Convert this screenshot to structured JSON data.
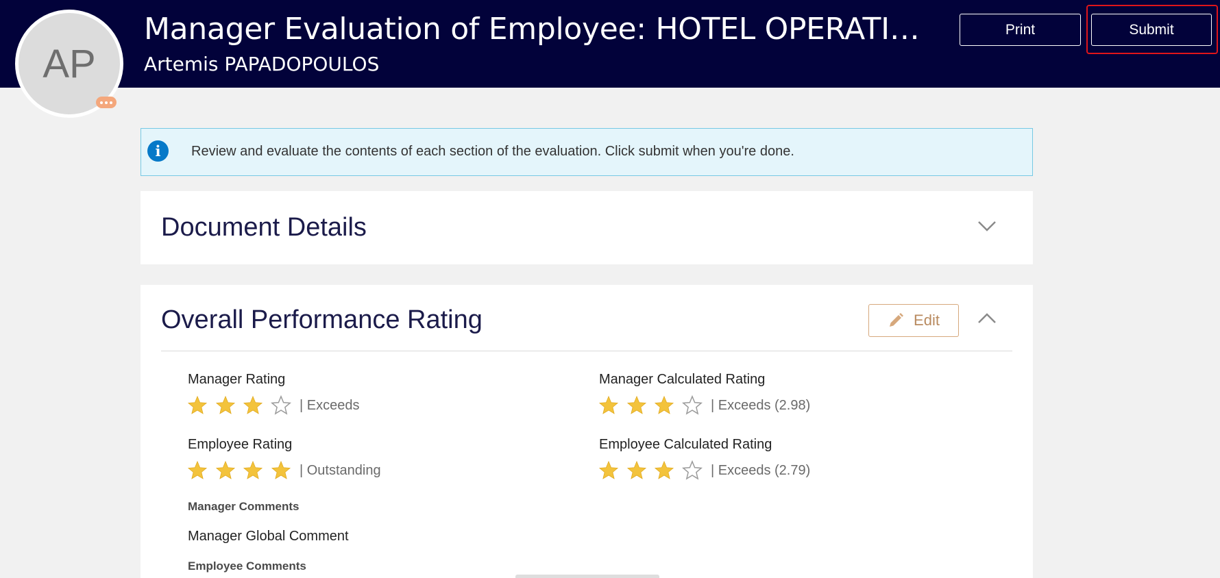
{
  "header": {
    "title": "Manager Evaluation of Employee: HOTEL OPERATIONS - GLOBAL",
    "subtitle": "Artemis PAPADOPOULOS",
    "avatar_initials": "AP",
    "print_label": "Print",
    "submit_label": "Submit",
    "background": "#02023a",
    "highlight_color": "#e0151a"
  },
  "info_banner": {
    "text": "Review and evaluate the contents of each section of the evaluation. Click submit when you're done.",
    "icon": "info-icon"
  },
  "document_details": {
    "title": "Document Details",
    "expanded": false
  },
  "overall_performance": {
    "title": "Overall Performance Rating",
    "edit_label": "Edit",
    "expanded": true,
    "manager_rating": {
      "label": "Manager Rating",
      "stars": 3,
      "max": 4,
      "text": "| Exceeds"
    },
    "employee_rating": {
      "label": "Employee Rating",
      "stars": 4,
      "max": 4,
      "text": "| Outstanding"
    },
    "manager_calculated": {
      "label": "Manager Calculated Rating",
      "stars": 3,
      "max": 4,
      "text": "| Exceeds (2.98)"
    },
    "employee_calculated": {
      "label": "Employee Calculated Rating",
      "stars": 3,
      "max": 4,
      "text": "| Exceeds (2.79)"
    },
    "manager_comments_label": "Manager Comments",
    "manager_comment": "Manager Global Comment",
    "employee_comments_label": "Employee Comments"
  },
  "colors": {
    "star_filled": "#f3c33c",
    "star_empty": "#9a9a9a",
    "accent": "#d6a87c"
  }
}
